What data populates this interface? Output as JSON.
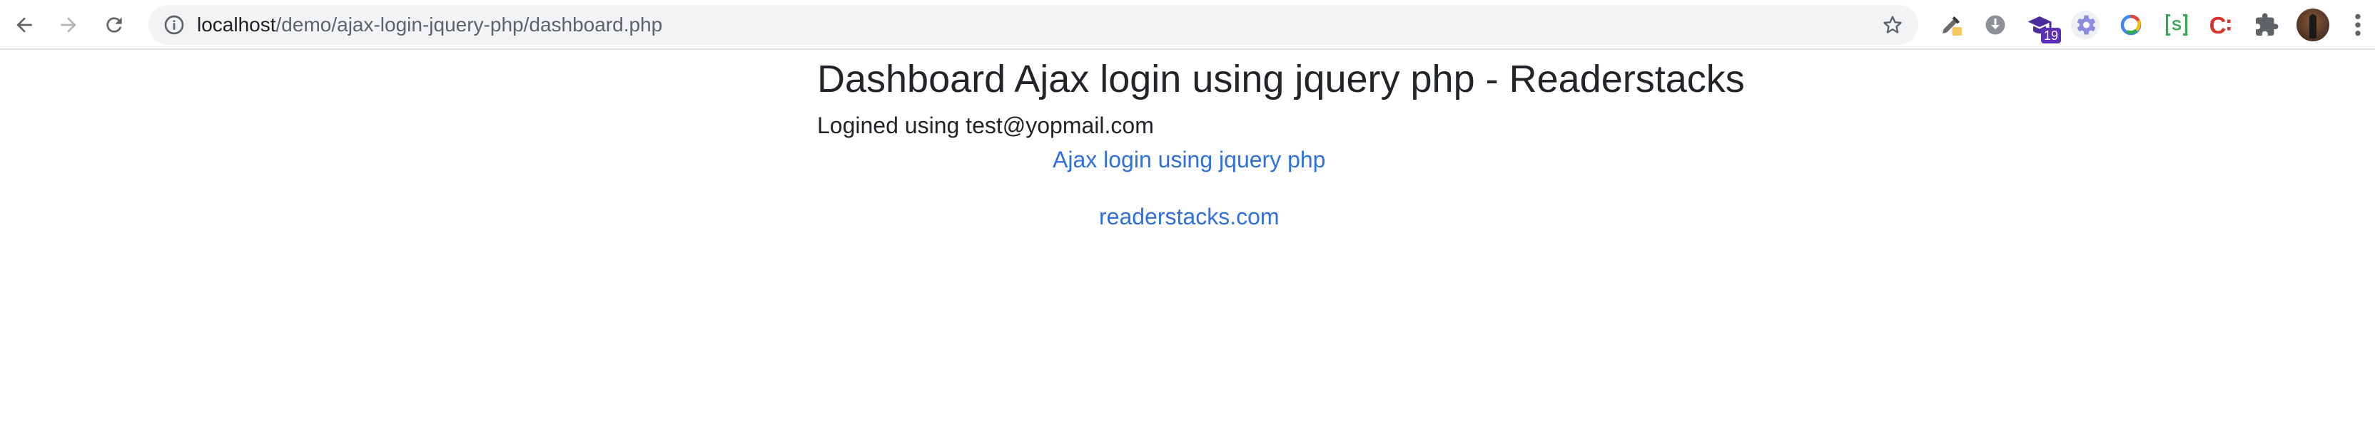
{
  "browser": {
    "url_host": "localhost",
    "url_path": "/demo/ajax-login-jquery-php/dashboard.php",
    "extensions": [
      {
        "icon": "eyedropper-icon"
      },
      {
        "icon": "download-circle-icon"
      },
      {
        "icon": "graduation-cap-icon",
        "badge": "19"
      },
      {
        "icon": "gear-icon"
      },
      {
        "icon": "chrome-ring-icon"
      },
      {
        "icon": "s-bracket-icon"
      },
      {
        "icon": "c-colon-icon"
      },
      {
        "icon": "puzzle-icon"
      }
    ]
  },
  "page": {
    "title": "Dashboard Ajax login using jquery php - Readerstacks",
    "login_info": "Logined using test@yopmail.com",
    "link_ajax": "Ajax login using jquery php",
    "link_site": "readerstacks.com"
  },
  "colors": {
    "link": "#2f6fde",
    "text": "#212529",
    "omnibox_bg": "#f1f3f4"
  }
}
